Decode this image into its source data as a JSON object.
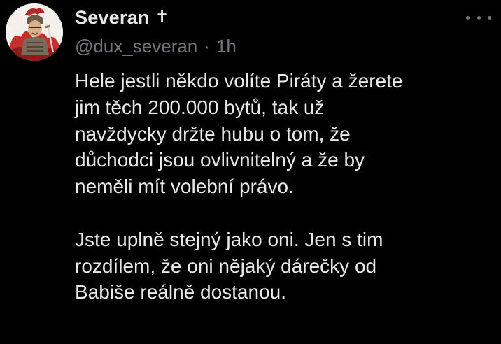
{
  "tweet": {
    "display_name": "Severan",
    "display_name_full": "Severan",
    "name_symbol": "✝",
    "handle": "@dux_severan",
    "separator": "·",
    "time": "1h",
    "more_icon": "more-horizontal-icon",
    "text": "Hele jestli někdo volíte Piráty a žerete\njim těch 200.000 bytů, tak už\nnavždycky držte hubu o tom, že\ndůchodci jsou ovlivnitelný a že by\nneměli mít volební právo.\n\nJste uplně stejný jako oni. Jen s tim\nrozdílem, že oni nějaký dárečky od\nBabiše reálně dostanou."
  },
  "colors": {
    "background": "#000000",
    "primary_text": "#e7e9ea",
    "secondary_text": "#71767b"
  }
}
